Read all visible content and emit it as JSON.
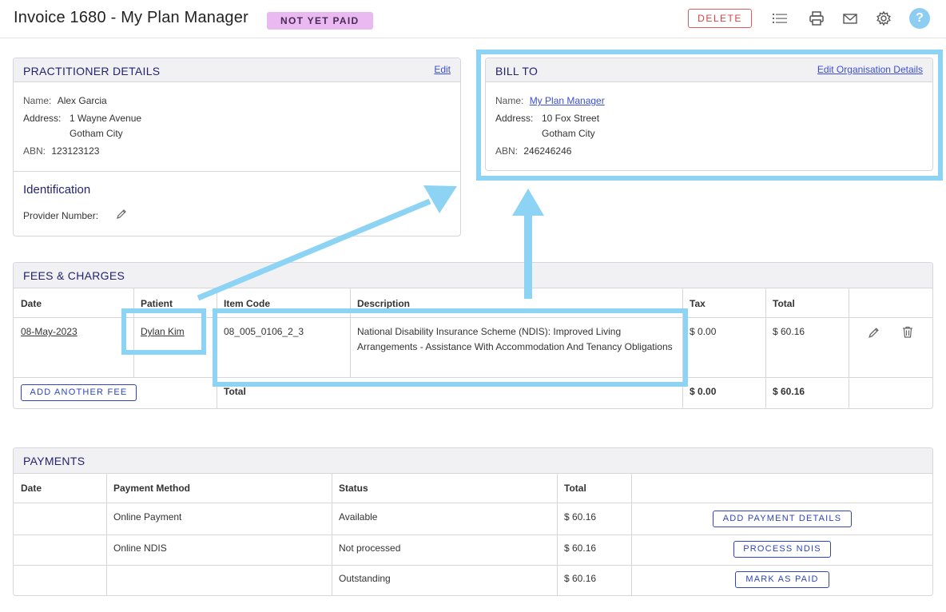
{
  "header": {
    "title": "Invoice 1680 - My Plan Manager",
    "status_badge": "NOT YET PAID",
    "delete_label": "DELETE",
    "help_label": "?"
  },
  "practitioner": {
    "heading": "PRACTITIONER DETAILS",
    "edit_label": "Edit",
    "name_label": "Name:",
    "name": "Alex Garcia",
    "address_label": "Address:",
    "address_line1": "1 Wayne Avenue",
    "address_line2": "Gotham City",
    "abn_label": "ABN:",
    "abn": "123123123",
    "identification_heading": "Identification",
    "provider_number_label": "Provider Number:"
  },
  "bill_to": {
    "heading": "BILL TO",
    "edit_label": "Edit Organisation Details",
    "name_label": "Name:",
    "name": "My Plan Manager",
    "address_label": "Address:",
    "address_line1": "10 Fox Street",
    "address_line2": "Gotham City",
    "abn_label": "ABN:",
    "abn": "246246246"
  },
  "fees": {
    "heading": "FEES & CHARGES",
    "columns": [
      "Date",
      "Patient",
      "Item Code",
      "Description",
      "Tax",
      "Total"
    ],
    "rows": [
      {
        "date": "08-May-2023",
        "patient": "Dylan Kim",
        "item_code": "08_005_0106_2_3",
        "description": "National Disability Insurance Scheme (NDIS): Improved Living Arrangements - Assistance With Accommodation And Tenancy Obligations",
        "tax": "$ 0.00",
        "total": "$ 60.16"
      }
    ],
    "add_fee_label": "ADD ANOTHER FEE",
    "total_label": "Total",
    "total_tax": "$ 0.00",
    "total_amount": "$ 60.16"
  },
  "payments": {
    "heading": "PAYMENTS",
    "columns": [
      "Date",
      "Payment Method",
      "Status",
      "Total"
    ],
    "rows": [
      {
        "date": "",
        "method": "Online Payment",
        "status": "Available",
        "total": "$ 60.16",
        "action": "ADD PAYMENT DETAILS"
      },
      {
        "date": "",
        "method": "Online NDIS",
        "status": "Not processed",
        "total": "$ 60.16",
        "action": "PROCESS NDIS"
      },
      {
        "date": "",
        "method": "",
        "status": "Outstanding",
        "total": "$ 60.16",
        "action": "MARK AS PAID"
      }
    ]
  },
  "icons": {
    "list": "list-icon",
    "print": "printer-icon",
    "email": "envelope-icon",
    "settings": "gear-icon",
    "help": "help-icon",
    "edit": "pencil-icon",
    "delete": "trash-icon"
  },
  "colors": {
    "accent": "#3b4fd6",
    "badge_bg": "#eab9f2",
    "delete": "#d44343",
    "highlight": "#8dd3f4",
    "heading": "#23236e"
  }
}
